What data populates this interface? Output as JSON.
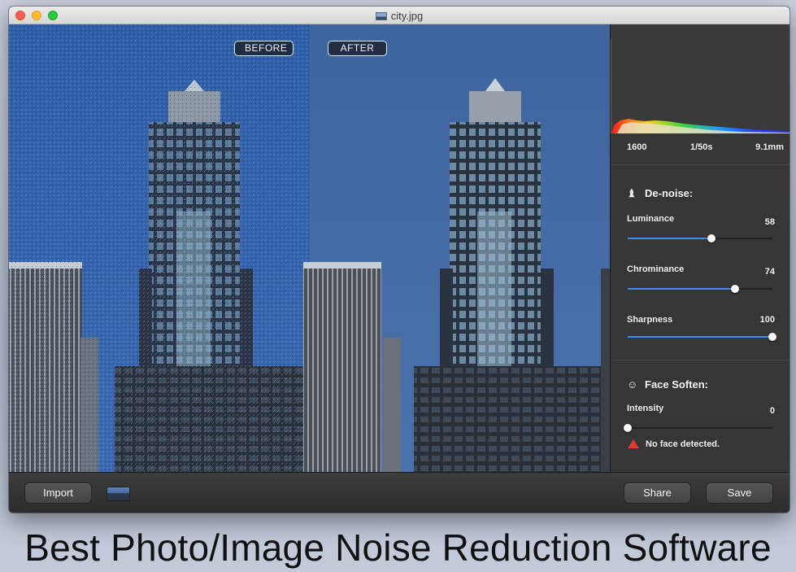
{
  "window": {
    "title": "city.jpg"
  },
  "photo": {
    "before_label": "BEFORE",
    "after_label": "AFTER"
  },
  "exif": {
    "iso": "1600",
    "shutter": "1/50s",
    "focal": "9.1mm"
  },
  "denoise": {
    "title": "De-noise:",
    "title_icon": "dropper-icon",
    "luminance": {
      "label": "Luminance",
      "value": "58",
      "level": 0.58
    },
    "chrominance": {
      "label": "Chrominance",
      "value": "74",
      "level": 0.74
    },
    "sharpness": {
      "label": "Sharpness",
      "value": "100",
      "level": 1.0
    }
  },
  "face": {
    "title": "Face Soften:",
    "title_icon": "face-profile-icon",
    "intensity": {
      "label": "Intensity",
      "value": "0",
      "level": 0
    },
    "warning": "No face detected."
  },
  "toolbar": {
    "import_label": "Import",
    "share_label": "Share",
    "save_label": "Save"
  },
  "caption": "Best Photo/Image Noise Reduction Software",
  "colors": {
    "accent": "#3d8cf0",
    "warning": "#e23b2f"
  }
}
